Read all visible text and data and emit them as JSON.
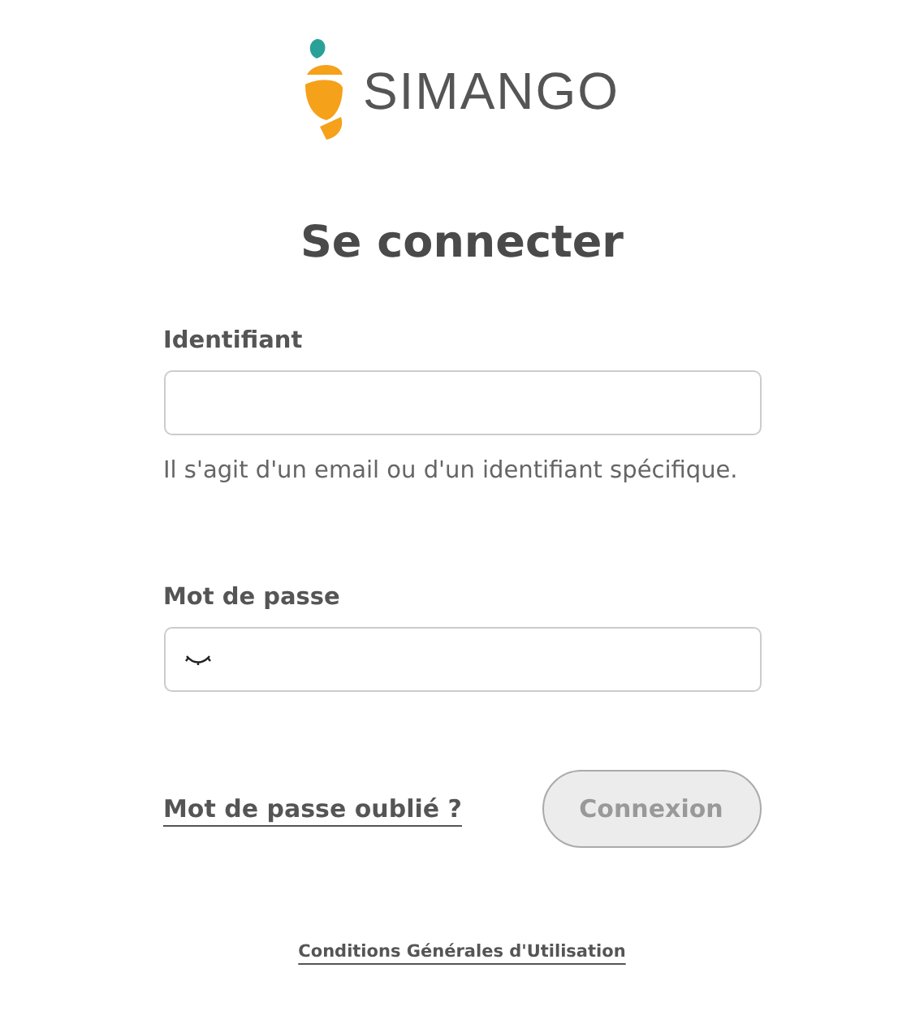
{
  "logo": {
    "text": "SIMANGO"
  },
  "title": "Se connecter",
  "fields": [
    {
      "kind": "text",
      "label": "Identifiant",
      "help": "Il s'agit d'un email ou d'un identifiant spécifique."
    },
    {
      "kind": "password",
      "label": "Mot de passe",
      "password_visible": false
    }
  ],
  "forgot_link": "Mot de passe oublié ?",
  "submit": {
    "label": "Connexion",
    "disabled": true
  },
  "footer_link": "Conditions Générales d'Utilisation"
}
